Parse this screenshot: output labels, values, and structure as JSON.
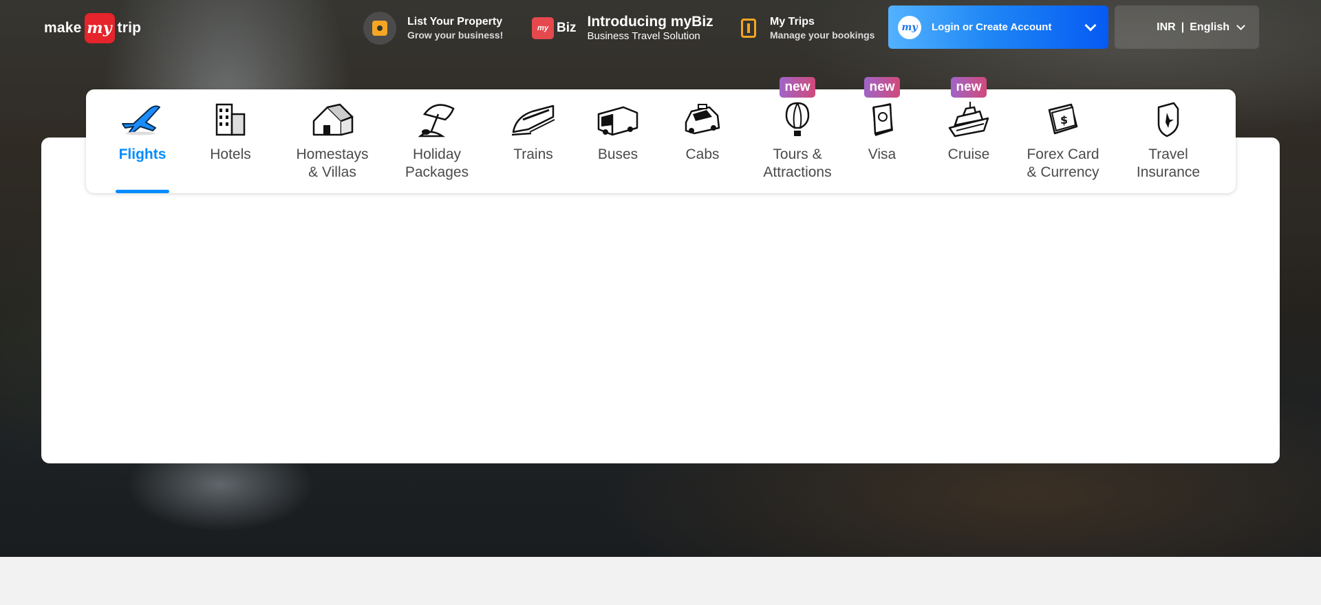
{
  "header": {
    "logo": {
      "left": "make",
      "badge": "my",
      "right": "trip"
    },
    "list_property": {
      "title": "List Your Property",
      "subtitle": "Grow your business!"
    },
    "mybiz": {
      "badge": "my",
      "brand": "Biz",
      "title": "Introducing myBiz",
      "subtitle": "Business Travel Solution"
    },
    "my_trips": {
      "title": "My Trips",
      "subtitle": "Manage your bookings"
    },
    "login": {
      "avatar": "my",
      "label": "Login or Create Account"
    },
    "currency": "INR",
    "language": "English"
  },
  "nav": {
    "items": [
      {
        "label": "Flights",
        "icon": "airplane-icon",
        "active": true
      },
      {
        "label": "Hotels",
        "icon": "hotel-building-icon"
      },
      {
        "label": "Homestays\n& Villas",
        "icon": "house-icon"
      },
      {
        "label": "Holiday\nPackages",
        "icon": "beach-umbrella-icon"
      },
      {
        "label": "Trains",
        "icon": "train-icon"
      },
      {
        "label": "Buses",
        "icon": "bus-icon"
      },
      {
        "label": "Cabs",
        "icon": "car-icon"
      },
      {
        "label": "Tours &\nAttractions",
        "icon": "hot-air-balloon-icon",
        "tag": "new"
      },
      {
        "label": "Visa",
        "icon": "passport-icon",
        "tag": "new"
      },
      {
        "label": "Cruise",
        "icon": "ship-icon",
        "tag": "new"
      },
      {
        "label": "Forex Card\n& Currency",
        "icon": "currency-card-icon"
      },
      {
        "label": "Travel\nInsurance",
        "icon": "insurance-shield-icon"
      }
    ]
  },
  "colors": {
    "accent": "#008cff",
    "brand_red": "#e5242b",
    "new_tag": "#b55aa6"
  }
}
